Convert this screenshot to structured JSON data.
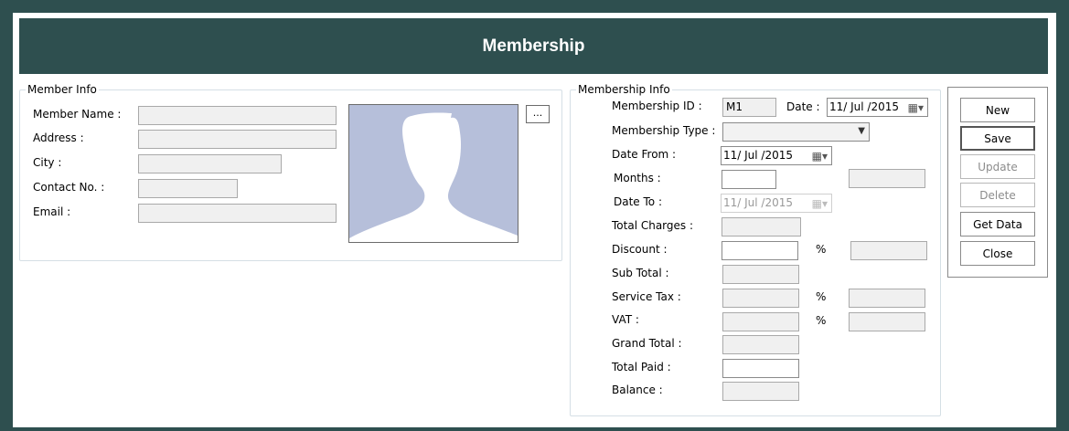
{
  "title": "Membership",
  "member_info": {
    "legend": "Member Info",
    "name_label": "Member Name :",
    "address_label": "Address :",
    "city_label": "City :",
    "contact_label": "Contact No. :",
    "email_label": "Email :",
    "browse_label": "..."
  },
  "membership_info": {
    "legend": "Membership Info",
    "id_label": "Membership ID :",
    "id_value": "M1",
    "date_label": "Date :",
    "date_value": "11/ Jul /2015",
    "type_label": "Membership Type :",
    "type_value": "",
    "date_from_label": "Date From :",
    "date_from_value": "11/ Jul /2015",
    "months_label": "Months :",
    "date_to_label": "Date To :",
    "date_to_value": "11/ Jul /2015",
    "total_charges_label": "Total Charges :",
    "discount_label": "Discount :",
    "percent_1": "%",
    "sub_total_label": "Sub Total :",
    "service_tax_label": "Service Tax :",
    "percent_2": "%",
    "vat_label": "VAT :",
    "percent_3": "%",
    "grand_total_label": "Grand Total :",
    "total_paid_label": "Total Paid :",
    "balance_label": "Balance :"
  },
  "buttons": {
    "new": "New",
    "save": "Save",
    "update": "Update",
    "delete": "Delete",
    "get_data": "Get Data",
    "close": "Close"
  },
  "colors": {
    "header_bg": "#2e4f4f",
    "photo_bg": "#b6bfda",
    "silhouette": "#ffffff"
  },
  "icons": {
    "calendar": "calendar-icon",
    "dropdown": "chevron-down-icon",
    "avatar": "person-silhouette-icon"
  }
}
